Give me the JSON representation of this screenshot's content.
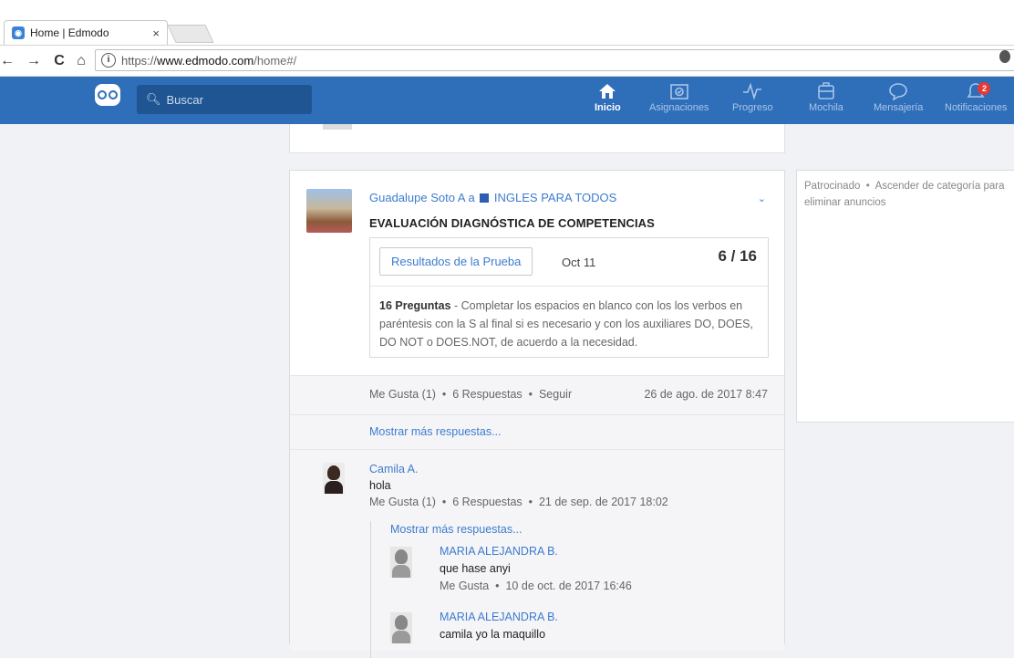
{
  "browser": {
    "tab_title": "Home | Edmodo",
    "tab_close": "×",
    "url_protocol": "https://",
    "url_host": "www.edmodo.com",
    "url_path": "/home#/",
    "back": "←",
    "forward": "→",
    "reload": "C",
    "home": "⌂",
    "info": "i"
  },
  "app": {
    "search_placeholder": "Buscar",
    "nav": [
      {
        "label": "Inicio",
        "icon": "home-icon",
        "active": true
      },
      {
        "label": "Asignaciones",
        "icon": "assignments-icon"
      },
      {
        "label": "Progreso",
        "icon": "progress-icon"
      },
      {
        "label": "Mochila",
        "icon": "backpack-icon"
      },
      {
        "label": "Mensajería",
        "icon": "message-icon"
      },
      {
        "label": "Notificaciones",
        "icon": "bell-icon",
        "badge": "2"
      }
    ],
    "accent": "#2f6eb8",
    "link_color": "#3c7ccf"
  },
  "post": {
    "author": "Guadalupe Soto A",
    "connector": "a",
    "group": "INGLES PARA TODOS",
    "title": "EVALUACIÓN DIAGNÓSTICA DE COMPETENCIAS",
    "quiz": {
      "button": "Resultados de la Prueba",
      "date": "Oct 11",
      "score": "6 / 16",
      "questions": "16 Preguntas",
      "description": " - Completar los espacios en blanco con los los verbos en paréntesis con la S al final si es necesario y con los auxiliares DO, DOES, DO NOT o DOES.NOT, de acuerdo a la necesidad."
    },
    "meta": {
      "like": "Me Gusta (1)",
      "replies": "6 Respuestas",
      "follow": "Seguir",
      "sep": "•",
      "timestamp": "26 de ago. de 2017 8:47"
    },
    "show_more": "Mostrar más respuestas..."
  },
  "comment": {
    "author": "Camila A.",
    "text": "hola",
    "like": "Me Gusta (1)",
    "replies": "6 Respuestas",
    "timestamp": "21 de sep. de 2017 18:02",
    "show_more": "Mostrar más respuestas...",
    "sub_replies": [
      {
        "author": "MARIA ALEJANDRA B.",
        "text": "que hase anyi",
        "like": "Me Gusta",
        "timestamp": "10 de oct. de 2017 16:46"
      },
      {
        "author": "MARIA ALEJANDRA B.",
        "text": "camila yo la maquillo"
      }
    ]
  },
  "sponsored": {
    "label": "Patrocinado",
    "sep": "•",
    "upgrade": "Ascender de categoría para",
    "upgrade2": "eliminar anuncios"
  }
}
